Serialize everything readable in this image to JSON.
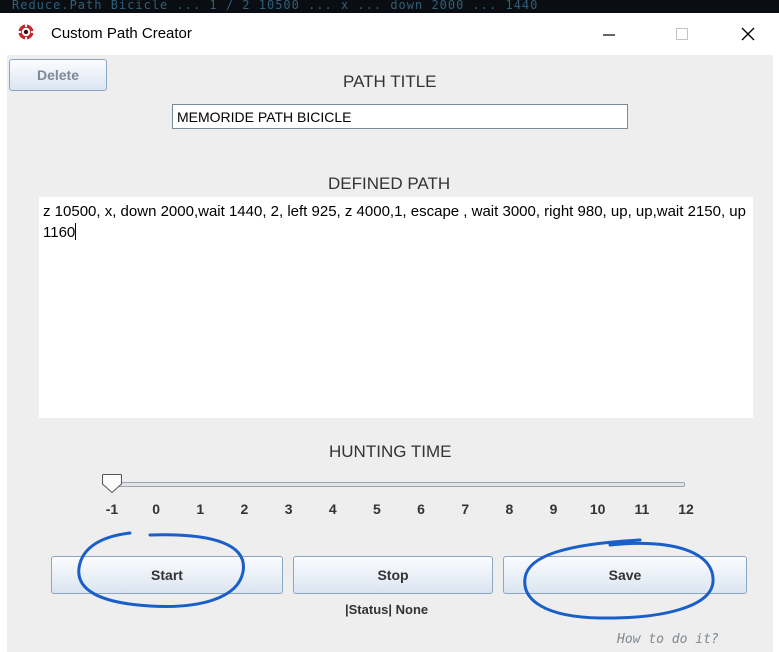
{
  "background_strip": {
    "text": "Reduce.Path Bicicle ... 1 / 2 10500 ... x ... down 2000 ... 1440"
  },
  "window": {
    "title": "Custom Path Creator",
    "icon": "red-circle-app-icon",
    "controls": {
      "minimize": "minimize-icon",
      "maximize": "maximize-icon",
      "close": "close-icon"
    }
  },
  "toolbar": {
    "delete_label": "Delete"
  },
  "path_title": {
    "label": "PATH TITLE",
    "value": "MEMORIDE PATH BICICLE"
  },
  "defined_path": {
    "label": "DEFINED PATH",
    "text": "z 10500, x, down 2000,wait 1440, 2, left 925, z 4000,1, escape , wait 3000, right 980, up, up,wait 2150, up 1160"
  },
  "hunting_time": {
    "label": "HUNTING TIME",
    "ticks": [
      "-1",
      "0",
      "1",
      "2",
      "3",
      "4",
      "5",
      "6",
      "7",
      "8",
      "9",
      "10",
      "11",
      "12"
    ],
    "min": -1,
    "max": 12,
    "value": -1
  },
  "actions": {
    "start_label": "Start",
    "stop_label": "Stop",
    "save_label": "Save"
  },
  "status": {
    "text": "|Status| None"
  },
  "help": {
    "link_text": "How to do it?"
  },
  "colors": {
    "annotation": "#1a5fc8",
    "button_border": "#8ca5c0",
    "app_icon": "#c0282d"
  }
}
